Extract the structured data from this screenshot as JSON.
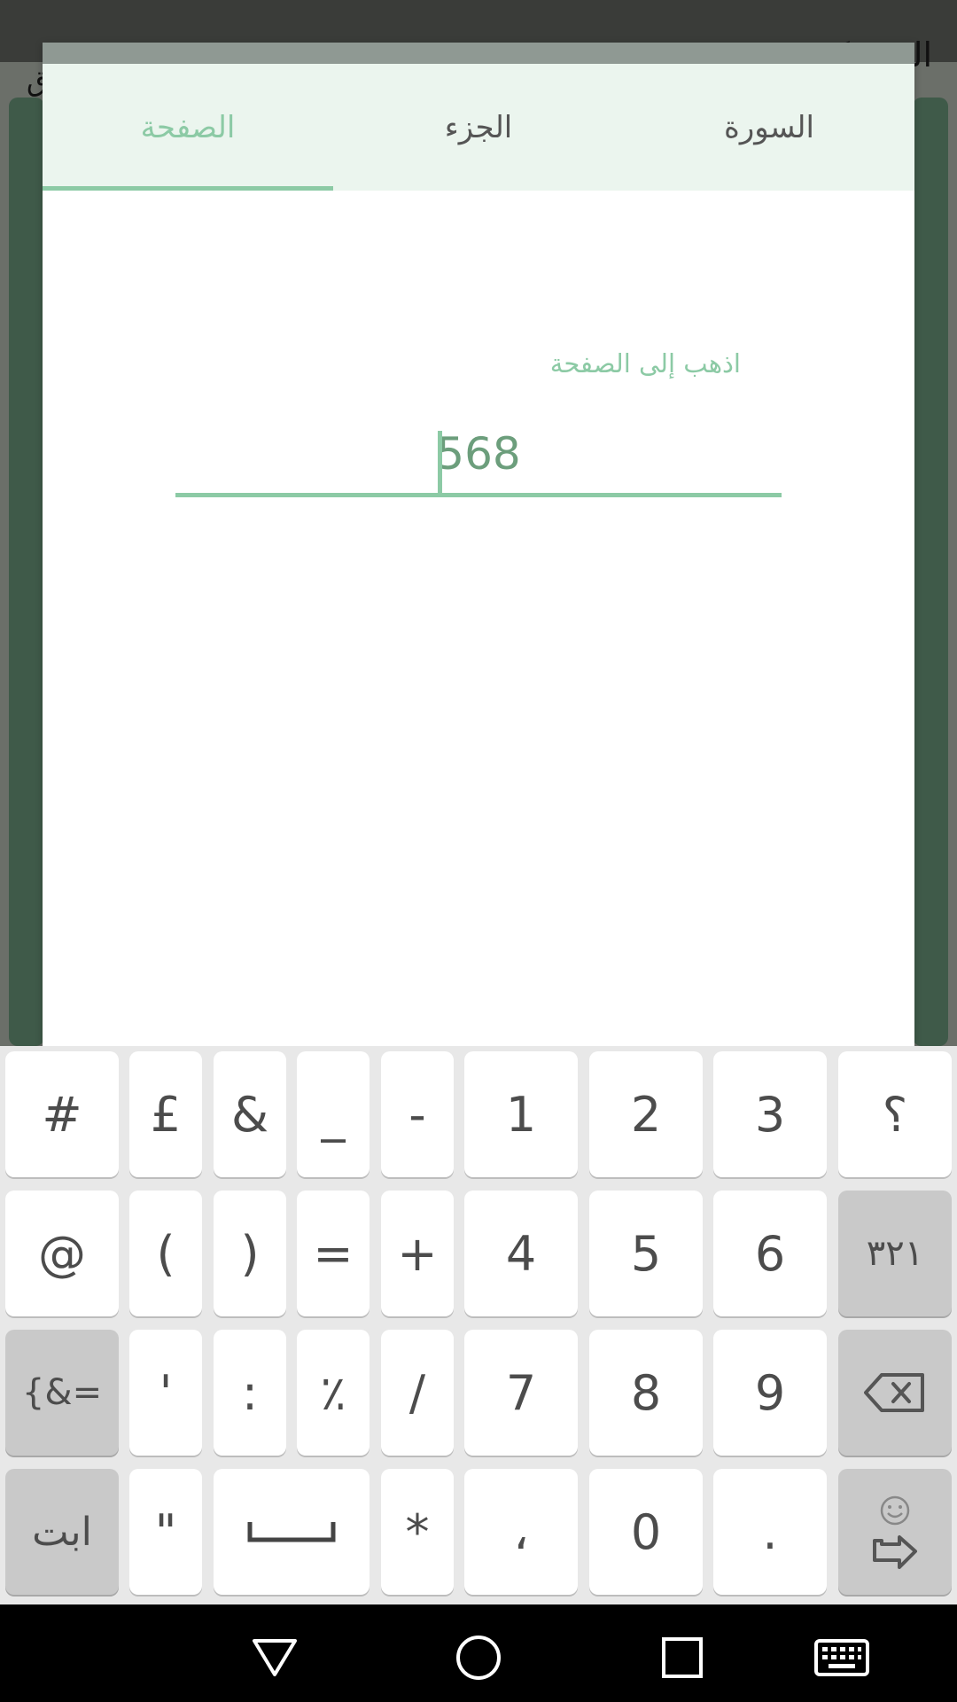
{
  "background": {
    "title_right": "السـ ـكـ",
    "title_left": "ق"
  },
  "dialog": {
    "tabs": [
      {
        "label": "السورة",
        "active": false
      },
      {
        "label": "الجزء",
        "active": false
      },
      {
        "label": "الصفحة",
        "active": true
      }
    ],
    "field_label": "اذهب إلى الصفحة",
    "field_value": "568"
  },
  "keyboard": {
    "rows": [
      [
        "#",
        "£",
        "&",
        "_",
        "-",
        "1",
        "2",
        "3",
        "؟"
      ],
      [
        "@",
        "(",
        ")",
        "=",
        "+",
        "4",
        "5",
        "6",
        "٣٢١"
      ],
      [
        "{&=",
        "'",
        ":",
        "٪",
        "/",
        "7",
        "8",
        "9",
        "backspace"
      ],
      [
        "ابت",
        "\"",
        "space",
        "*",
        "،",
        "0",
        ".",
        "enter"
      ]
    ]
  },
  "colors": {
    "accent": "#8ccaa5",
    "tab_bg": "#ebf5ee",
    "input_text": "#6c9e7c"
  }
}
